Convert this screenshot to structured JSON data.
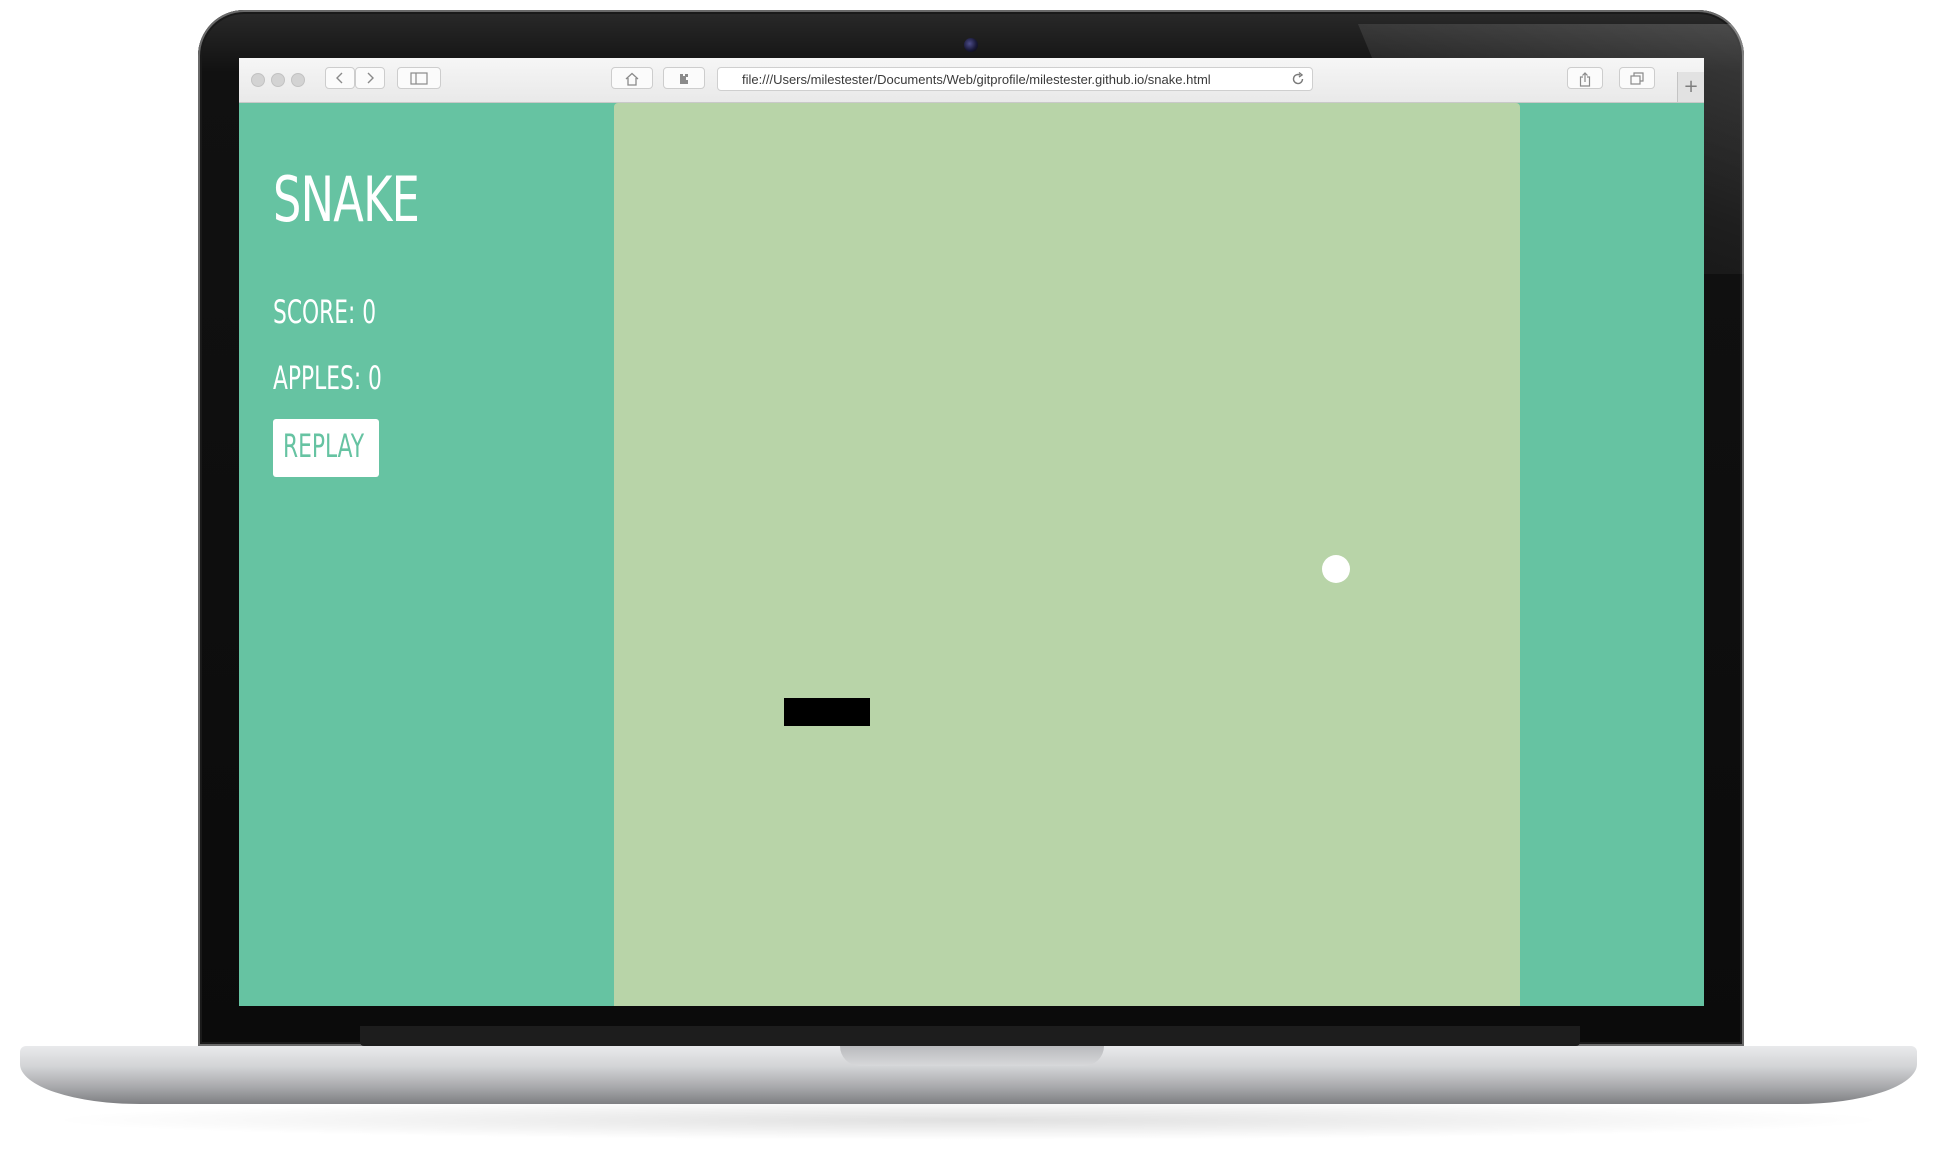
{
  "browser": {
    "url": "file:///Users/milestester/Documents/Web/gitprofile/milestester.github.io/snake.html",
    "icons": {
      "back": "chevron-left-icon",
      "forward": "chevron-right-icon",
      "sidebar": "sidebar-icon",
      "home": "home-icon",
      "extension": "puzzle-icon",
      "reload": "reload-icon",
      "share": "share-icon",
      "tabs": "tabs-icon",
      "new_tab": "plus-icon"
    },
    "new_tab_label": "+"
  },
  "game": {
    "title": "SNAKE",
    "score_label": "SCORE: 0",
    "apples_label": "APPLES: 0",
    "replay_label": "REPLAY"
  },
  "colors": {
    "page_background": "#66c3a2",
    "board_background": "#b8d4a8",
    "snake": "#000000",
    "apple": "#ffffff"
  }
}
